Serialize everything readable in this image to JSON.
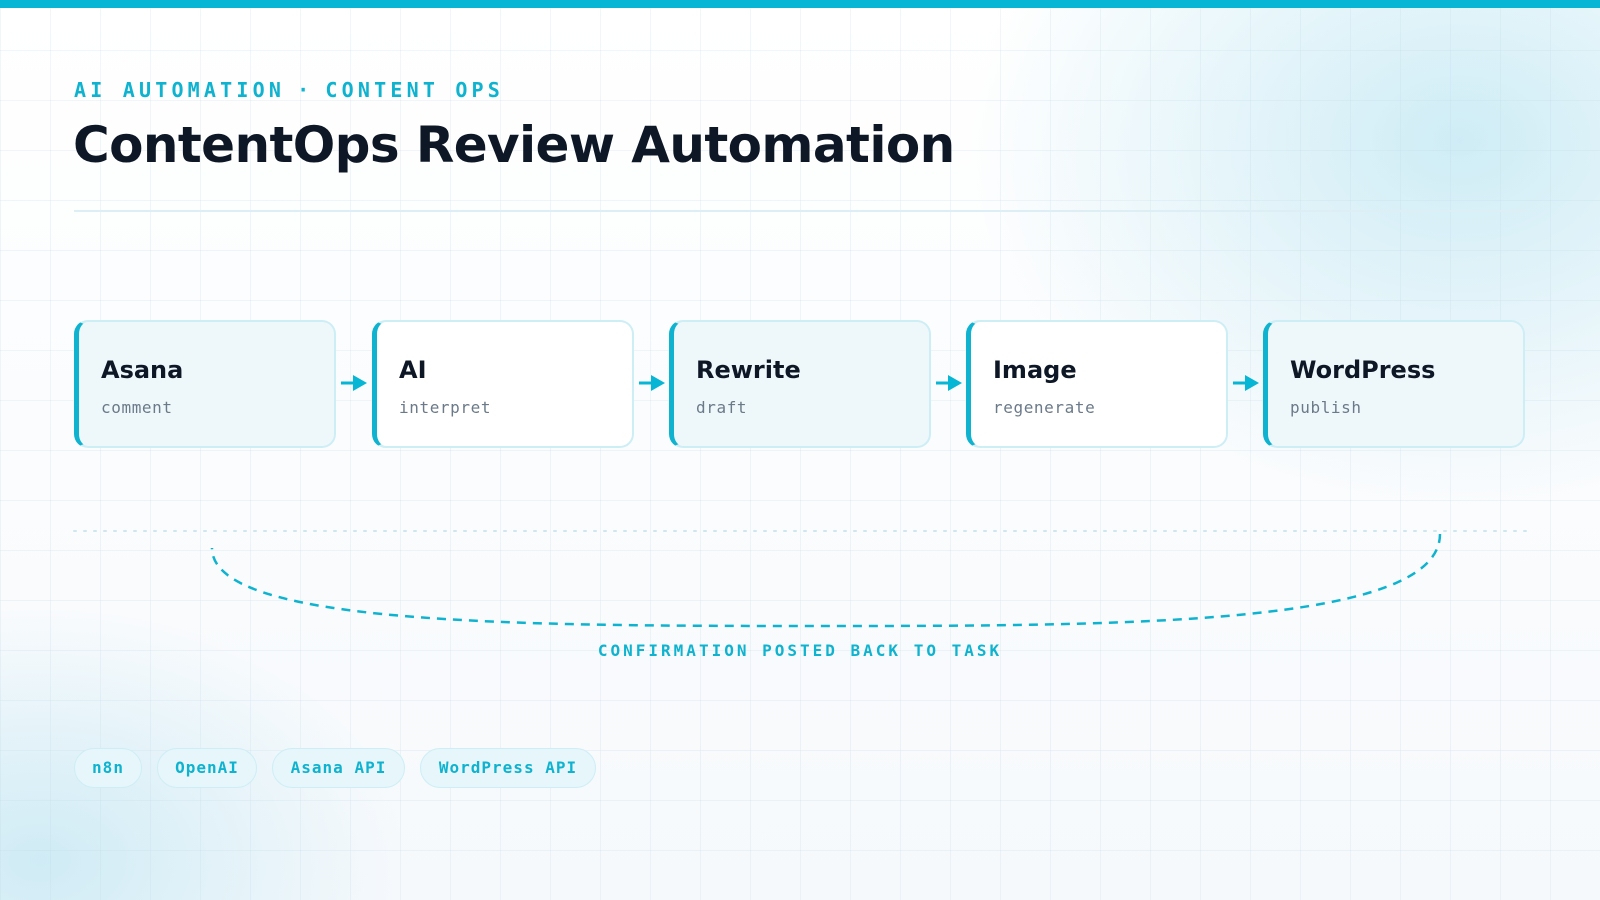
{
  "header": {
    "eyebrow_left": "AI AUTOMATION",
    "eyebrow_sep": "·",
    "eyebrow_right": "CONTENT OPS",
    "title": "ContentOps Review Automation"
  },
  "steps": [
    {
      "title": "Asana",
      "subtitle": "comment"
    },
    {
      "title": "AI",
      "subtitle": "interpret"
    },
    {
      "title": "Rewrite",
      "subtitle": "draft"
    },
    {
      "title": "Image",
      "subtitle": "regenerate"
    },
    {
      "title": "WordPress",
      "subtitle": "publish"
    }
  ],
  "loop": {
    "label": "CONFIRMATION POSTED BACK TO TASK"
  },
  "tags": [
    "n8n",
    "OpenAI",
    "Asana API",
    "WordPress API"
  ],
  "colors": {
    "accent": "#06b6d4",
    "text": "#0e1726",
    "muted": "#6b7a88",
    "border": "#cdeef5"
  }
}
